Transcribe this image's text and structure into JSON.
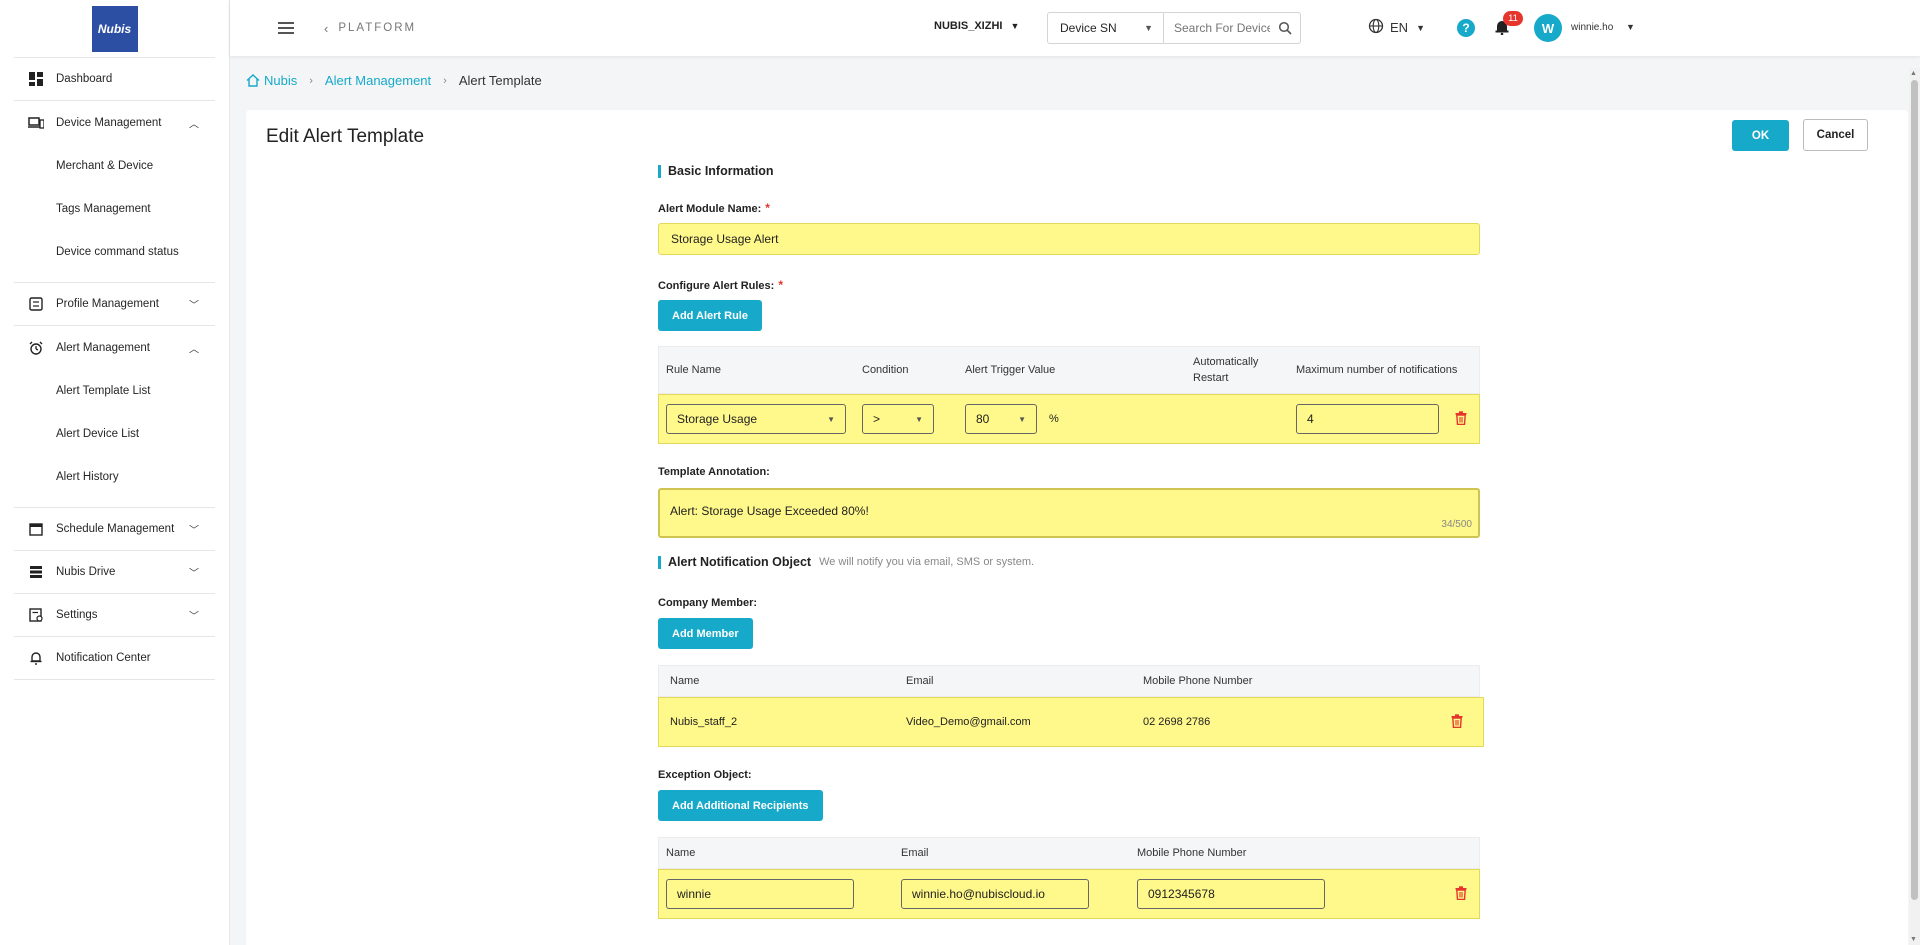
{
  "sidebar": {
    "logo_text": "Nubis",
    "items": [
      {
        "label": "Dashboard"
      },
      {
        "label": "Device Management"
      },
      {
        "label": "Merchant & Device"
      },
      {
        "label": "Tags Management"
      },
      {
        "label": "Device command status"
      },
      {
        "label": "Profile Management"
      },
      {
        "label": "Alert Management"
      },
      {
        "label": "Alert Template List"
      },
      {
        "label": "Alert Device List"
      },
      {
        "label": "Alert History"
      },
      {
        "label": "Schedule Management"
      },
      {
        "label": "Nubis Drive"
      },
      {
        "label": "Settings"
      },
      {
        "label": "Notification Center"
      }
    ]
  },
  "header": {
    "platform": "PLATFORM",
    "org": "NUBIS_XIZHI",
    "search_type": "Device SN",
    "search_placeholder": "Search For Devices Across",
    "lang": "EN",
    "help": "?",
    "notification_count": "11",
    "avatar_initial": "W",
    "username": "winnie.ho"
  },
  "breadcrumb": {
    "home": "Nubis",
    "parent": "Alert Management",
    "current": "Alert Template"
  },
  "page": {
    "title": "Edit Alert Template",
    "ok": "OK",
    "cancel": "Cancel"
  },
  "basic": {
    "section_title": "Basic Information",
    "module_name_label": "Alert Module Name:",
    "module_name_value": "Storage Usage Alert",
    "rules_label": "Configure Alert Rules:",
    "add_rule": "Add Alert Rule",
    "columns": {
      "rule_name": "Rule Name",
      "condition": "Condition",
      "trigger": "Alert Trigger Value",
      "auto_restart_1": "Automatically",
      "auto_restart_2": "Restart",
      "max_notifications": "Maximum number of notifications"
    },
    "rule": {
      "name": "Storage Usage",
      "condition": ">",
      "trigger": "80",
      "unit": "%",
      "max": "4"
    },
    "annotation_label": "Template Annotation:",
    "annotation_value": "Alert: Storage Usage Exceeded 80%!",
    "annotation_counter": "34/500"
  },
  "notify": {
    "section_title": "Alert Notification Object",
    "section_hint": "We will notify you via email, SMS or system.",
    "company_label": "Company Member:",
    "add_member": "Add Member",
    "columns": {
      "name": "Name",
      "email": "Email",
      "phone": "Mobile Phone Number"
    },
    "member": {
      "name": "Nubis_staff_2",
      "email": "Video_Demo@gmail.com",
      "phone": "02 2698 2786"
    },
    "exception_label": "Exception Object:",
    "add_recipients": "Add Additional Recipients",
    "recipient": {
      "name": "winnie",
      "email": "winnie.ho@nubiscloud.io",
      "phone": "0912345678"
    }
  },
  "colors": {
    "accent": "#16a9c9",
    "highlight": "#fff88a",
    "danger": "#e5352c"
  }
}
